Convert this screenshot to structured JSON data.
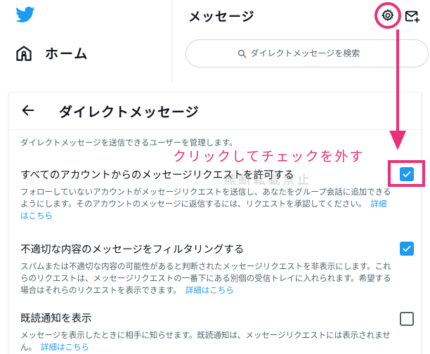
{
  "top": {
    "home_label": "ホーム",
    "messages_title": "メッセージ",
    "search_placeholder": "ダイレクトメッセージを検索"
  },
  "panel": {
    "title": "ダイレクトメッセージ",
    "description": "ダイレクトメッセージを送信できるユーザーを管理します。",
    "settings": [
      {
        "title": "すべてのアカウントからのメッセージリクエストを許可する",
        "text": "フォローしていないアカウントがメッセージリクエストを送信し、あなたをグループ会話に追加できるようにします。そのアカウントのメッセージに返信するには、リクエストを承認してください。",
        "link": "詳細はこちら",
        "checked": true
      },
      {
        "title": "不適切な内容のメッセージをフィルタリングする",
        "text": "スパムまたは不適切な内容の可能性があると判断されたメッセージリクエストを非表示にします。これらのリクエストは、メッセージリクエストの一番下にある別個の受信トレイに入れられます。希望する場合はそれらのリクエストを表示できます。",
        "link": "詳細はこちら",
        "checked": true
      },
      {
        "title": "既読通知を表示",
        "text": "メッセージを表示したときに相手に知らせます。既読通知は、メッセージリクエストには表示されません。",
        "link": "詳細はこちら",
        "checked": false
      }
    ]
  },
  "annotation": {
    "instruction": "クリックしてチェックを外す",
    "watermark": "無断転載禁止"
  },
  "colors": {
    "accent": "#1d9bf0",
    "annotation": "#e8317a",
    "text_secondary": "#536471"
  },
  "icons": [
    "twitter-logo-icon",
    "home-icon",
    "gear-icon",
    "new-message-icon",
    "search-icon",
    "back-arrow-icon",
    "checkmark-icon"
  ]
}
